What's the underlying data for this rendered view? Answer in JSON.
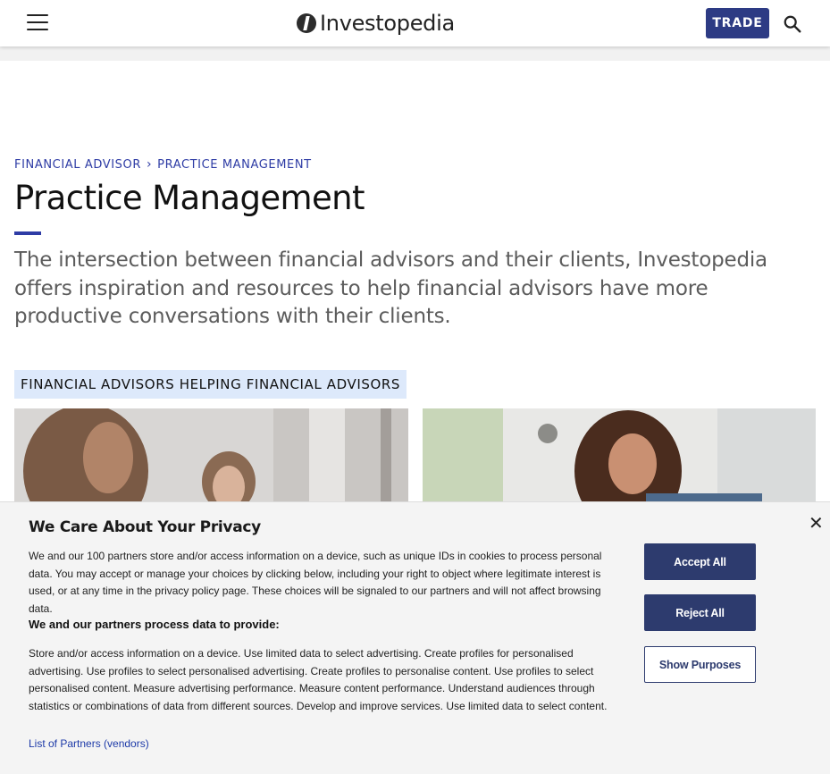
{
  "header": {
    "logo_text": "Investopedia",
    "trade_label": "TRADE"
  },
  "breadcrumb": {
    "items": [
      "FINANCIAL ADVISOR",
      "PRACTICE MANAGEMENT"
    ],
    "separator": "›"
  },
  "page": {
    "title": "Practice Management",
    "intro": "The intersection between financial advisors and their clients, Investopedia offers inspiration and resources to help financial advisors have more productive conversations with their clients.",
    "section_tag": "FINANCIAL ADVISORS HELPING FINANCIAL ADVISORS"
  },
  "privacy": {
    "heading": "We Care About Your Privacy",
    "body": "We and our 100 partners store and/or access information on a device, such as unique IDs in cookies to process personal data. You may accept or manage your choices by clicking below, including your right to object where legitimate interest is used, or at any time in the privacy policy page. These choices will be signaled to our partners and will not affect browsing data.",
    "sub_heading": "We and our partners process data to provide:",
    "purposes": "Store and/or access information on a device. Use limited data to select advertising. Create profiles for personalised advertising. Use profiles to select personalised advertising. Create profiles to personalise content. Use profiles to select personalised content. Measure advertising performance. Measure content performance. Understand audiences through statistics or combinations of data from different sources. Develop and improve services. Use limited data to select content.",
    "partners_link": "List of Partners (vendors)",
    "accept_label": "Accept All",
    "reject_label": "Reject All",
    "purposes_label": "Show Purposes",
    "close_glyph": "✕"
  },
  "colors": {
    "brand": "#2d3b84",
    "link": "#2e3ca5",
    "tag_bg": "#dde9fb",
    "consent_button": "#2d3b6e"
  },
  "icons": [
    "menu-icon",
    "logo-icon",
    "search-icon",
    "chevron-right-icon",
    "close-icon"
  ]
}
